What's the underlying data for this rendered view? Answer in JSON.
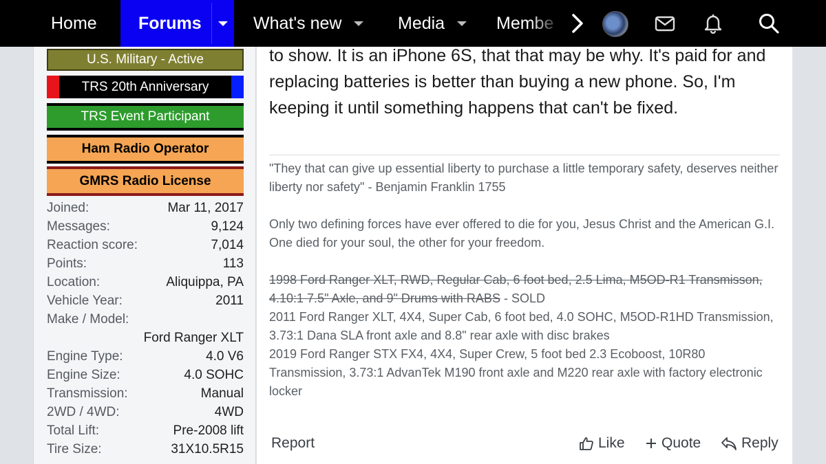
{
  "nav": {
    "home": "Home",
    "forums": "Forums",
    "whats_new": "What's new",
    "media": "Media",
    "members": "Membe"
  },
  "banners": [
    "U.S. Military - Active",
    "TRS 20th Anniversary",
    "TRS Event Participant",
    "Ham Radio Operator",
    "GMRS Radio License"
  ],
  "stats": [
    {
      "k": "Joined:",
      "v": "Mar 11, 2017"
    },
    {
      "k": "Messages:",
      "v": "9,124"
    },
    {
      "k": "Reaction score:",
      "v": "7,014"
    },
    {
      "k": "Points:",
      "v": "113"
    },
    {
      "k": "Location:",
      "v": "Aliquippa, PA"
    },
    {
      "k": "Vehicle Year:",
      "v": "2011"
    },
    {
      "k": "Make / Model:",
      "v": ""
    },
    {
      "k": "",
      "v": "Ford Ranger XLT"
    },
    {
      "k": "Engine Type:",
      "v": "4.0 V6"
    },
    {
      "k": "Engine Size:",
      "v": "4.0 SOHC"
    },
    {
      "k": "Transmission:",
      "v": "Manual"
    },
    {
      "k": "2WD / 4WD:",
      "v": "4WD"
    },
    {
      "k": "Total Lift:",
      "v": "Pre-2008 lift"
    },
    {
      "k": "Tire Size:",
      "v": "31X10.5R15"
    }
  ],
  "post": {
    "body": "to show. It is an iPhone 6S, that that may be why. It's paid for and replacing batteries is better than buying a new phone. So, I'm keeping it until something happens that can't be fixed."
  },
  "signature": {
    "quote": "\"They that can give up essential liberty to purchase a little temporary safety, deserves neither liberty nor safety\" - Benjamin Franklin 1755",
    "forces": "Only two defining forces have ever offered to die for you, Jesus Christ and the American G.I. One died for your soul, the other for your freedom.",
    "truck1_struck": "1998 Ford Ranger XLT, RWD, Regular Cab, 6 foot bed, 2.5 Lima, M5OD-R1 Transmisson, 4.10:1 7.5\" Axle, and 9\" Drums with RABS",
    "truck1_status": " - SOLD",
    "truck2": "2011 Ford Ranger XLT, 4X4, Super Cab, 6 foot bed, 4.0 SOHC, M5OD-R1HD Transmission, 3.73:1 Dana SLA front axle and 8.8\" rear axle with disc brakes",
    "truck3": "2019 Ford Ranger STX FX4, 4X4, Super Crew, 5 foot bed 2.3 Ecoboost, 10R80 Transmission, 3.73:1 AdvanTek M190 front axle and M220 rear axle with factory electronic locker"
  },
  "actions": {
    "report": "Report",
    "like": "Like",
    "quote": "Quote",
    "reply": "Reply"
  },
  "icons": {
    "arrow": "chevron-right-icon",
    "avatar": "user-avatar",
    "mail": "envelope-icon",
    "bell": "bell-icon",
    "search": "search-icon",
    "like": "thumbs-up-icon",
    "quote": "plus-icon",
    "reply": "reply-icon"
  },
  "colors": {
    "nav_active": "#0a00f2",
    "military": "#7f7f32",
    "event": "#2d9c2d",
    "ham": "#f5a553"
  }
}
